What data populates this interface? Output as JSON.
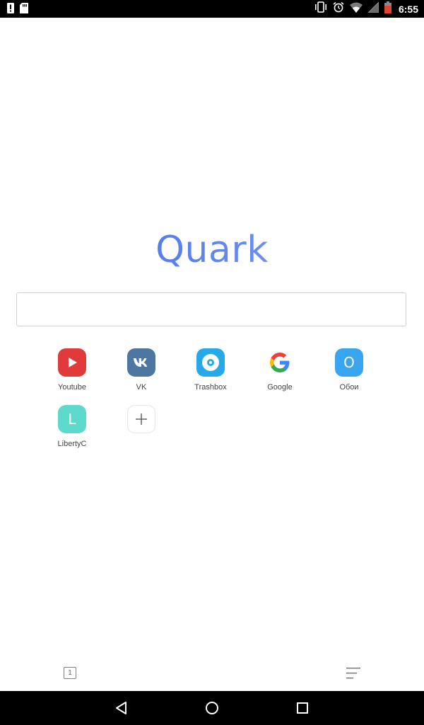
{
  "status_bar": {
    "time": "6:55",
    "left_icons": [
      "warning-icon",
      "sd-card-icon"
    ],
    "right_icons": [
      "vibrate-icon",
      "alarm-icon",
      "wifi-icon",
      "signal-icon",
      "battery-icon"
    ]
  },
  "logo": {
    "text": "Quark"
  },
  "search": {
    "value": "",
    "placeholder": ""
  },
  "shortcuts": [
    {
      "label": "Youtube",
      "icon": "youtube-icon",
      "color": "#e03a3a"
    },
    {
      "label": "VK",
      "icon": "vk-icon",
      "color": "#4d76a1"
    },
    {
      "label": "Trashbox",
      "icon": "trashbox-icon",
      "color": "#26a9e8"
    },
    {
      "label": "Google",
      "icon": "google-icon",
      "color": "#ffffff"
    },
    {
      "label": "Обои",
      "icon": "oboi-icon",
      "letter": "O",
      "color": "#39a4ef"
    },
    {
      "label": "LibertyC",
      "icon": "libertyc-icon",
      "letter": "L",
      "color": "#5ddacb"
    },
    {
      "label": "",
      "icon": "plus-icon",
      "color": "#ffffff"
    }
  ],
  "toolbar": {
    "tab_count": "1",
    "menu_icon": "menu-lines-icon"
  },
  "nav_bar": {
    "icons": [
      "back-triangle-icon",
      "home-circle-icon",
      "recents-square-icon"
    ]
  }
}
